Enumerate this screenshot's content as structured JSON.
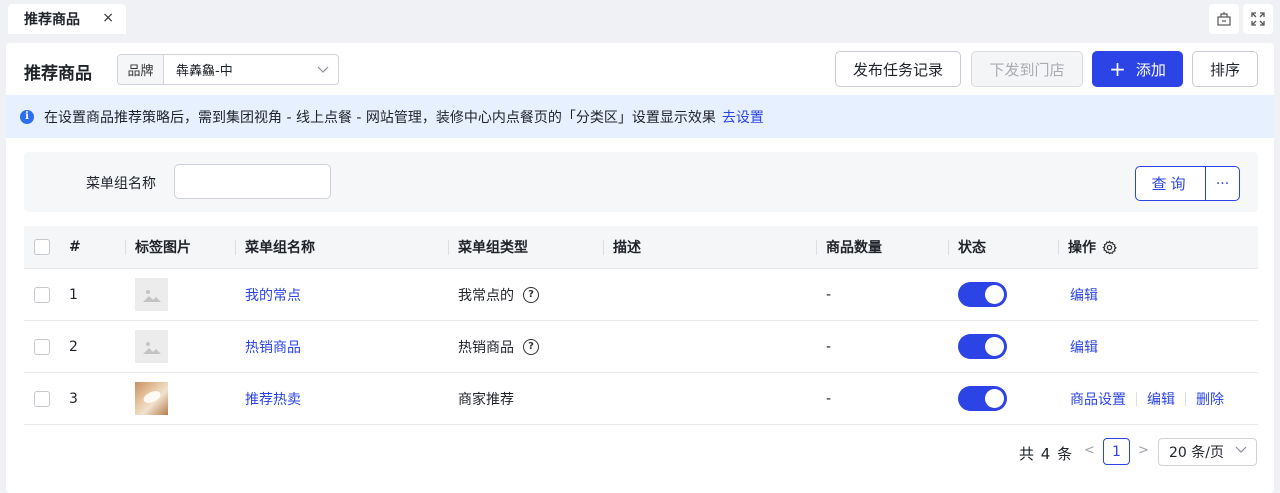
{
  "tabs": [
    {
      "label": "推荐商品",
      "close": "×"
    }
  ],
  "header": {
    "title": "推荐商品",
    "brand_prefix": "品牌",
    "brand_value": "犇羴鱻-中",
    "btn_publish_log": "发布任务记录",
    "btn_dispatch": "下发到门店",
    "btn_add": "添加",
    "btn_add_icon": "+",
    "btn_sort": "排序"
  },
  "alert": {
    "icon": "i",
    "text": "在设置商品推荐策略后，需到集团视角 - 线上点餐 - 网站管理，装修中心内点餐页的「分类区」设置显示效果",
    "link": "去设置"
  },
  "filter": {
    "label": "菜单组名称",
    "value": "",
    "query_label": "查询",
    "more_label": "···"
  },
  "table": {
    "columns": {
      "index": "#",
      "image": "标签图片",
      "name": "菜单组名称",
      "type": "菜单组类型",
      "desc": "描述",
      "count": "商品数量",
      "status": "状态",
      "ops": "操作"
    },
    "rows": [
      {
        "index": "1",
        "image": "placeholder-image-icon",
        "name": "我的常点",
        "type": "我常点的",
        "has_help": true,
        "desc": "",
        "count": "-",
        "status_on": true,
        "ops": [
          "编辑"
        ]
      },
      {
        "index": "2",
        "image": "placeholder-image-icon",
        "name": "热销商品",
        "type": "热销商品",
        "has_help": true,
        "desc": "",
        "count": "-",
        "status_on": true,
        "ops": [
          "编辑"
        ]
      },
      {
        "index": "3",
        "image": "photo",
        "name": "推荐热卖",
        "type": "商家推荐",
        "has_help": false,
        "desc": "",
        "count": "-",
        "status_on": true,
        "ops": [
          "商品设置",
          "编辑",
          "删除"
        ]
      }
    ]
  },
  "pagination": {
    "total": "共 4 条",
    "prev": "<",
    "current_page": "1",
    "next": ">",
    "page_size": "20 条/页"
  },
  "colors": {
    "primary": "#2c44e6",
    "alert_bg": "#e7f0ff"
  }
}
